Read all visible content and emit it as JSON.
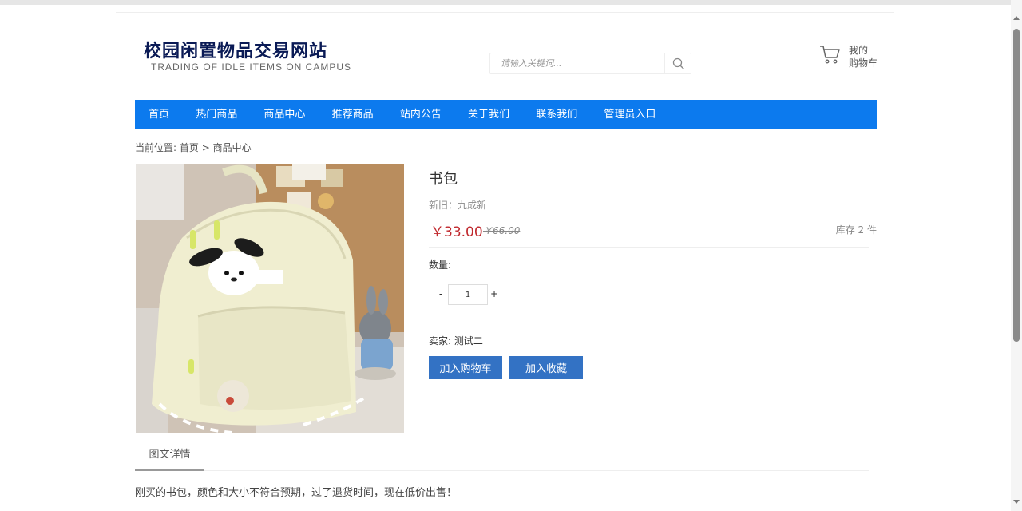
{
  "header": {
    "logo_title": "校园闲置物品交易网站",
    "logo_subtitle": "TRADING OF IDLE ITEMS ON CAMPUS",
    "search_placeholder": "请输入关键词...",
    "search_icon": "search-icon",
    "cart_icon": "cart-icon",
    "cart_line1": "我的",
    "cart_line2": "购物车"
  },
  "nav": {
    "items": [
      {
        "label": "首页"
      },
      {
        "label": "热门商品"
      },
      {
        "label": "商品中心"
      },
      {
        "label": "推荐商品"
      },
      {
        "label": "站内公告"
      },
      {
        "label": "关于我们"
      },
      {
        "label": "联系我们"
      },
      {
        "label": "管理员入口"
      }
    ],
    "color": "#0c7aee"
  },
  "breadcrumb": {
    "prefix": "当前位置:",
    "home": "首页",
    "separator": ">",
    "current": "商品中心"
  },
  "product": {
    "title": "书包",
    "condition": "新旧：九成新",
    "price": "￥33.00",
    "old_price": "￥66.00",
    "stock": "库存 2 件",
    "qty_label": "数量:",
    "qty_minus": "-",
    "qty_value": "1",
    "qty_plus": "+",
    "seller": "卖家: 测试二",
    "add_cart_label": "加入购物车",
    "add_fav_label": "加入收藏",
    "button_color": "#3372c4",
    "price_color": "#c0282d"
  },
  "details": {
    "tab_label": "图文详情",
    "description": "刚买的书包，颜色和大小不符合预期，过了退货时间，现在低价出售！"
  }
}
